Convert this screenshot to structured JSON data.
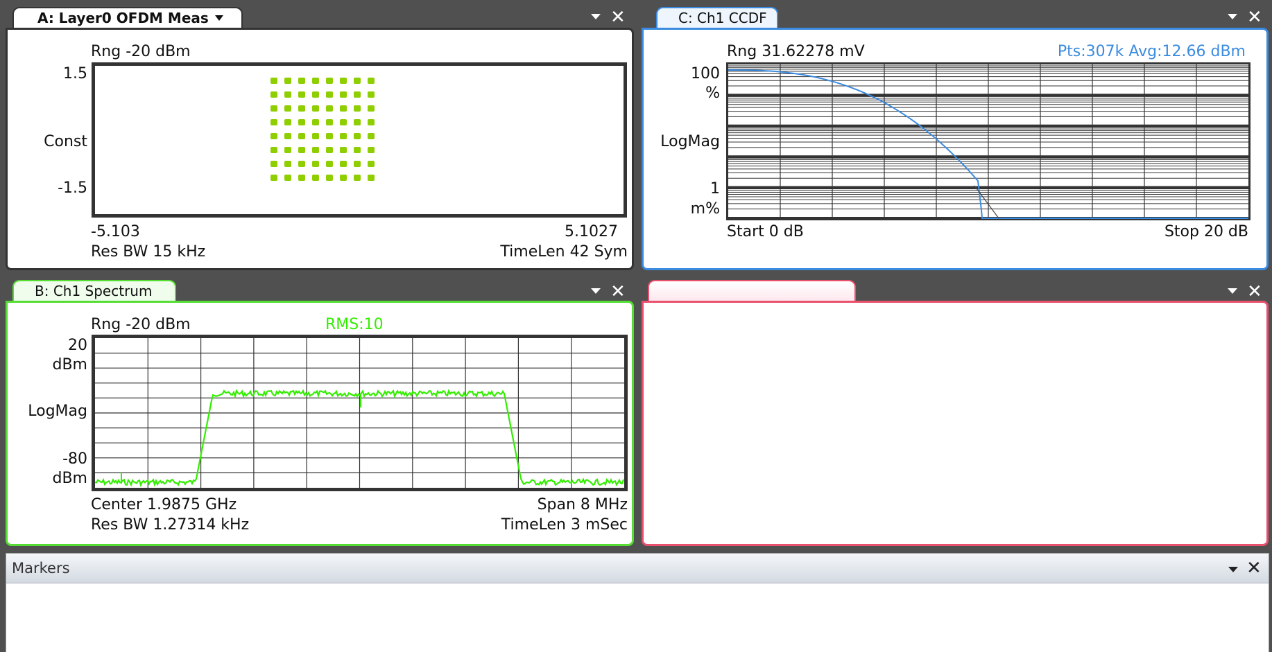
{
  "windows": {
    "a": {
      "tab_title": "A: Layer0 OFDM Meas",
      "range": "Rng -20 dBm",
      "y_top": "1.5",
      "y_mid": "Const",
      "y_bottom": "-1.5",
      "x_left": "-5.103",
      "x_right": "5.1027",
      "res_bw": "Res BW 15 kHz",
      "time_len": "TimeLen 42  Sym",
      "colors": {
        "accent": "#333333",
        "trace": "#8fce00"
      }
    },
    "c": {
      "tab_title": "C: Ch1 CCDF",
      "range": "Rng 31.62278 mV",
      "info": "Pts:307k Avg:12.66 dBm",
      "y_top": "100",
      "y_top_unit": "%",
      "y_mid": "LogMag",
      "y_low": "1",
      "y_low_unit": "m%",
      "x_start": "Start 0 dB",
      "x_stop": "Stop 20 dB",
      "colors": {
        "accent": "#3b8be0",
        "trace": "#3b8be0"
      }
    },
    "b": {
      "tab_title": "B: Ch1 Spectrum",
      "range": "Rng -20 dBm",
      "rms": "RMS:10",
      "y_top": "20",
      "y_top_unit": "dBm",
      "y_mid": "LogMag",
      "y_bottom": "-80",
      "y_bottom_unit": "dBm",
      "center": "Center 1.9875 GHz",
      "span": "Span 8 MHz",
      "res_bw": "Res BW 1.27314 kHz",
      "time_len": "TimeLen 3 mSec",
      "colors": {
        "accent": "#55dd33",
        "trace": "#33ee00"
      }
    },
    "d": {
      "tab_title": "",
      "colors": {
        "accent": "#e8506e"
      }
    }
  },
  "markers": {
    "title": "Markers"
  },
  "icons": {
    "dropdown": "chevron-down-icon",
    "close": "close-icon"
  }
}
